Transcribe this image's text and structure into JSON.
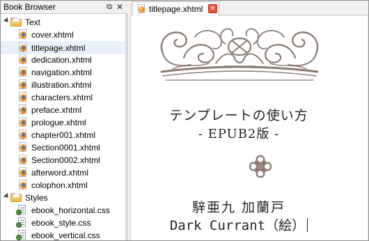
{
  "book_browser": {
    "title": "Book Browser",
    "float_icon": "float-window-icon",
    "close_icon": "close-icon",
    "folders": [
      {
        "label": "Text",
        "items": [
          {
            "label": "cover.xhtml"
          },
          {
            "label": "titlepage.xhtml",
            "selected": true
          },
          {
            "label": "dedication.xhtml"
          },
          {
            "label": "navigation.xhtml"
          },
          {
            "label": "illustration.xhtml"
          },
          {
            "label": "characters.xhtml"
          },
          {
            "label": "preface.xhtml"
          },
          {
            "label": "prologue.xhtml"
          },
          {
            "label": "chapter001.xhtml"
          },
          {
            "label": "Section0001.xhtml"
          },
          {
            "label": "Section0002.xhtml"
          },
          {
            "label": "afterword.xhtml"
          },
          {
            "label": "colophon.xhtml"
          }
        ]
      },
      {
        "label": "Styles",
        "items": [
          {
            "label": "ebook_horizontal.css"
          },
          {
            "label": "ebook_style.css"
          },
          {
            "label": "ebook_vertical.css"
          }
        ]
      }
    ]
  },
  "editor": {
    "tabs": [
      {
        "label": "titlepage.xhtml",
        "active": true,
        "close_glyph": "✕"
      }
    ],
    "document": {
      "title_line1": "テンプレートの使い方",
      "title_line2": "- EPUB2版 -",
      "author_line1": "騂亜九 加蘭戸",
      "author_line2": "Dark Currant（絵）"
    }
  },
  "colors": {
    "ornament": "#8a7a72",
    "selection": "#e8f0fa",
    "tab_close": "#e0543a"
  }
}
